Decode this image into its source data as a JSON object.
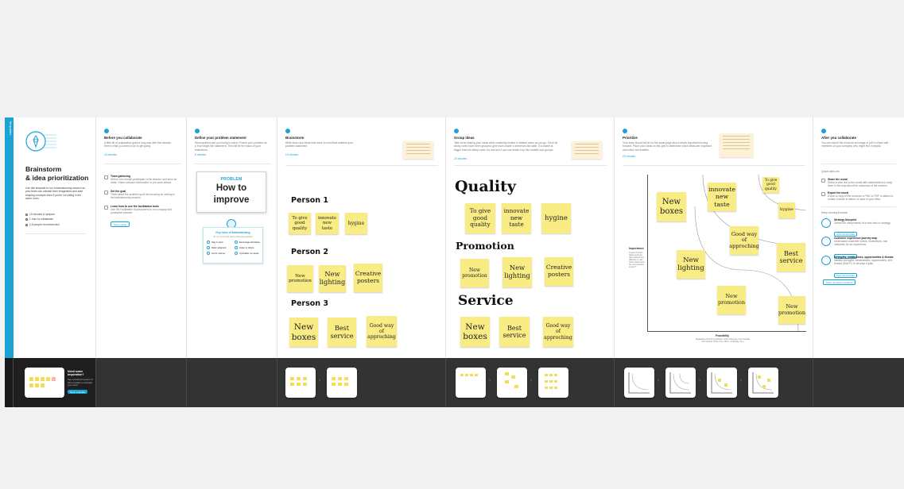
{
  "sidebar": {
    "tag": "Templates"
  },
  "intro": {
    "title_line1": "Brainstorm",
    "title_line2": "& idea prioritization",
    "description": "Use this template to run a brainstorming session so your team can unleash their imagination and start shaping concepts even if you're not sitting in the same room.",
    "meta": [
      "10 minutes to prepare",
      "1 hour to collaborate",
      "2-8 people recommended"
    ],
    "strip_title": "Need some inspiration?",
    "strip_desc": "See a finished version of this template to kickstart your work.",
    "strip_button": "Open example"
  },
  "panels": {
    "before": {
      "title": "Before you collaborate",
      "desc": "A little bit of preparation goes a long way with this session. Here's what you need to do to get going.",
      "link": "10 minutes",
      "checks": [
        {
          "title": "Team gathering",
          "desc": "Define who should participate in the session and send an invite. Share relevant information or pre-work ahead."
        },
        {
          "title": "Set the goal",
          "desc": "Think about the problem you'll be focusing on solving in the brainstorming session."
        },
        {
          "title": "Learn how to use the facilitation tools",
          "desc": "Use the Facilitation Superpowers to run a happy and productive session."
        }
      ],
      "check_link": "Open article"
    },
    "define": {
      "title": "Define your problem statement",
      "desc": "What problem are you trying to solve? Frame your problem as a How Might We statement. This will be the focus of your brainstorm.",
      "link": "5 minutes",
      "problem_label": "PROBLEM",
      "problem_text": "How to improve",
      "tips_title": "Key rules of brainstorming",
      "tips_sub": "To run a smooth and productive session",
      "tips": [
        "Stay in topic.",
        "Encourage wild ideas.",
        "Defer judgment.",
        "Listen to others.",
        "Go for volume.",
        "If possible, be visual."
      ]
    },
    "brainstorm": {
      "title": "Brainstorm",
      "desc": "Write down any ideas that come to mind that address your problem statement.",
      "link": "10 minutes",
      "persons": [
        "Person 1",
        "Person 2",
        "Person 3"
      ],
      "stickies": [
        "To give good quality",
        "innovate new taste",
        "hygine",
        "New promotion",
        "New lighting",
        "Creative posters",
        "New boxes",
        "Best service",
        "Good way of approching"
      ]
    },
    "group": {
      "title": "Group ideas",
      "desc": "Take turns sharing your ideas while clustering similar or related notes as you go. Once all sticky notes have been grouped, give each cluster a sentence-like label. If a cluster is bigger than six sticky notes, try and see if you can break it up into smaller sub-groups.",
      "link": "20 minutes",
      "headings": [
        "Quality",
        "Promotion",
        "Service"
      ],
      "stickies": [
        "To give good quality",
        "innovate new taste",
        "hygine",
        "New promotion",
        "New lighting",
        "Creative posters",
        "New boxes",
        "Best service",
        "Good way of approching"
      ]
    },
    "prioritize": {
      "title": "Prioritize",
      "desc": "Your team should all be on the same page about what's important moving forward. Place your ideas on this grid to determine which ideas are important and which are feasible.",
      "link": "20 minutes",
      "y_label": "Importance",
      "y_desc": "If each of these tasks could get done without any difficulty or cost, which would have the most positive impact?",
      "x_label": "Feasibility",
      "x_desc": "Regardless of their importance, which tasks are more feasible than others? (Cost, time, effort, complexity, etc.)",
      "stickies": [
        "New boxes",
        "innovate new taste",
        "To give good quality",
        "hygine",
        "Good way of approching",
        "New lighting",
        "Best service",
        "New promotion",
        "New promotion"
      ]
    },
    "after": {
      "title": "After you collaborate",
      "desc": "You can export the mural as an image or pdf to share with members of your company who might find it helpful.",
      "quick_title": "Quick add-ons",
      "quick_items": [
        {
          "title": "Share the mural",
          "desc": "Share a view link to the mural with stakeholders to keep them in the loop about the outcomes of the session."
        },
        {
          "title": "Export the mural",
          "desc": "Export a copy of the mural as a PNG or PDF to attach to emails, include in slides, or save in your drive."
        }
      ],
      "keep_title": "Keep moving forward",
      "keep_items": [
        {
          "title": "Strategy blueprint",
          "desc": "Define the components of a new idea or strategy.",
          "link": "Open the template"
        },
        {
          "title": "Customer experience journey map",
          "desc": "Understand customer needs, motivations, and obstacles for an experience.",
          "link": "Open the template"
        },
        {
          "title": "Strengths, weaknesses, opportunities & threats",
          "desc": "Identify strengths, weaknesses, opportunities, and threats (SWOT) to develop a plan.",
          "link": "Open the template"
        }
      ],
      "share_link": "Share template feedback"
    }
  },
  "colors": {
    "accent": "#1aa3d4",
    "sticky": "#f9ec84",
    "strip": "#333333"
  }
}
